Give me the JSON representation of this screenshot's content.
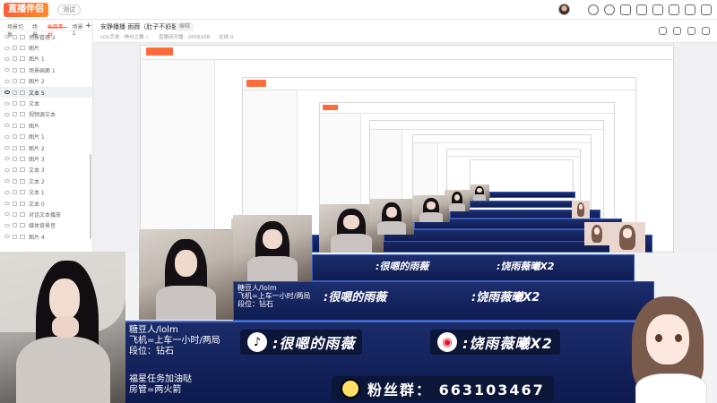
{
  "app": {
    "logo": "直播伴侣",
    "beta": "测试"
  },
  "scene_tabs": [
    "场景切换",
    "场景",
    "画面素材",
    "场景1"
  ],
  "scene_items": [
    "场景管理 2",
    "图片",
    "图片 1",
    "场景画面 1",
    "图片 2",
    "文本 5",
    "文本",
    "视频源文本",
    "图片",
    "图片 1",
    "图片 2",
    "图片 3",
    "文本 3",
    "文本 2",
    "文本 1",
    "文本 0",
    "对话文本播放",
    "媒体背景音",
    "图片 4"
  ],
  "room": {
    "title": "安静播播 雨薇（肚子不舒服版）",
    "edit": "编辑",
    "meta": [
      "LOL手游 · 神州之舞 ✓",
      "直播间开播 · 2656168",
      "在线 0"
    ]
  },
  "overlay": {
    "line1": "糖豆人/lolm",
    "line2": "飞机=上车一小时/两局",
    "line3": "段位：钻石",
    "line4": "福星任务加油哒",
    "line5": "房管=两火箭",
    "tiktok_label": ":很嗯的雨薇",
    "weibo_label": ":饶雨薇曦X2",
    "qq_label": "粉丝群： 663103467"
  },
  "colors": {
    "accent": "#ff5a3c",
    "banner": "#1b2c6a"
  }
}
